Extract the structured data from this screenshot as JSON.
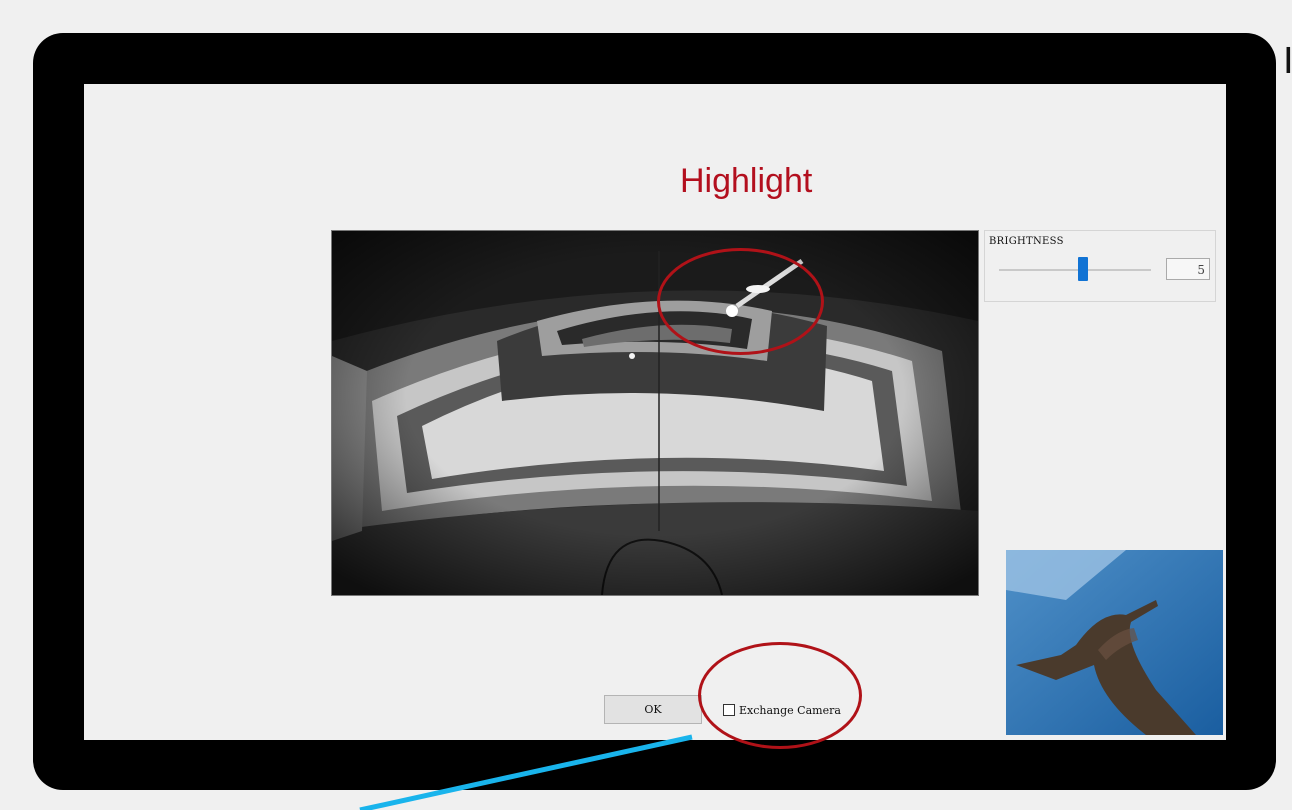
{
  "title": "Highlight",
  "edge_letter": "I",
  "brightness": {
    "label": "BRIGHTNESS",
    "value": "5",
    "level": 0.55
  },
  "ok_label": "OK",
  "exchange_camera_label": "Exchange Camera",
  "exchange_camera_checked": false,
  "colors": {
    "title": "#b30f1e",
    "highlight_ring": "#b01218",
    "arrow": "#19b4ec",
    "slider_thumb": "#1173d4",
    "bezel": "#000000"
  }
}
